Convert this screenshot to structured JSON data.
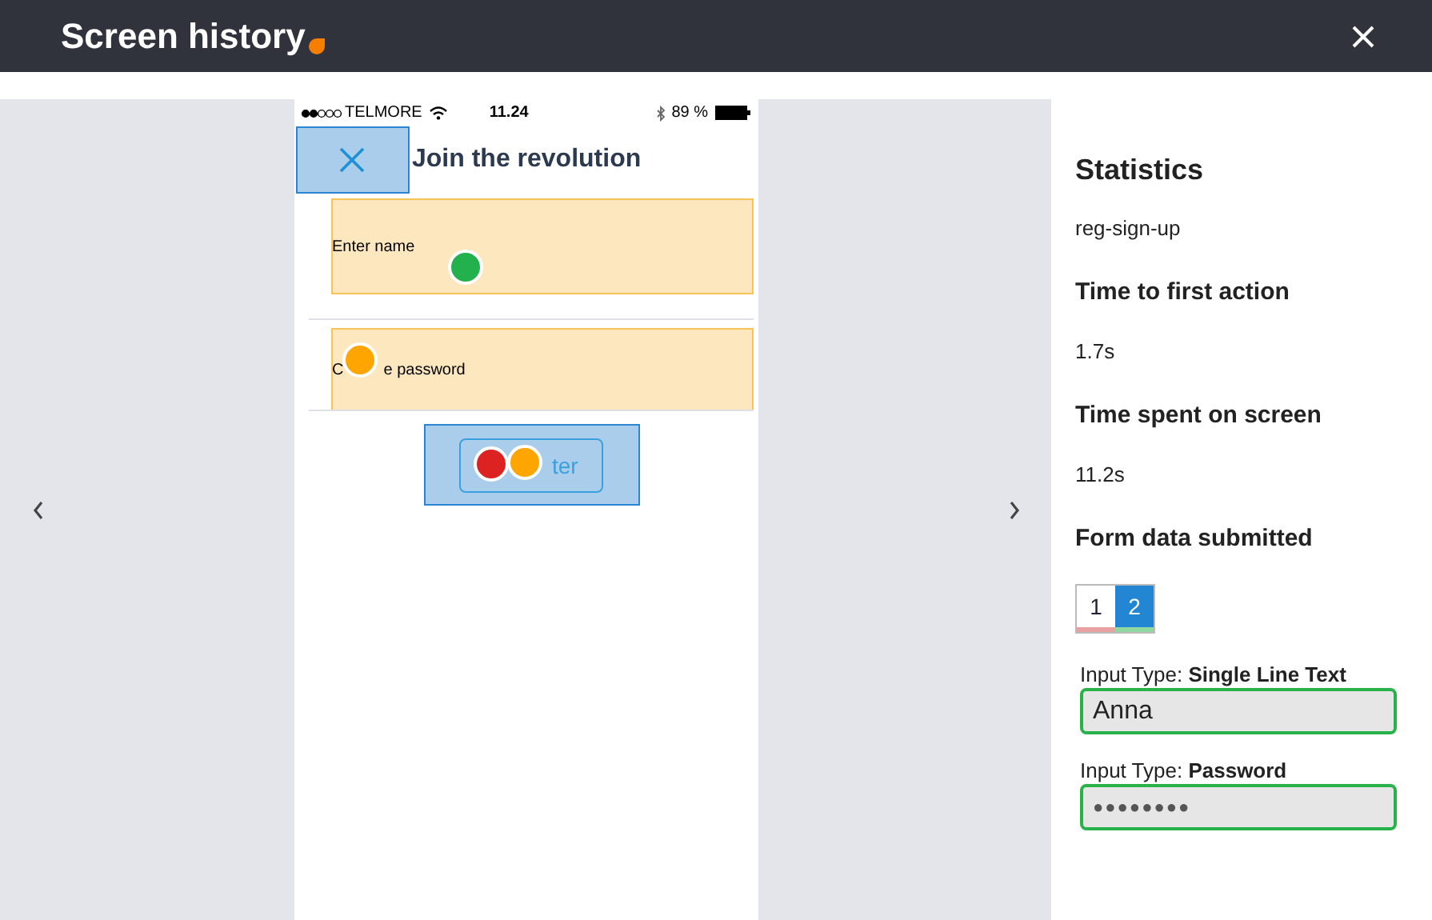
{
  "header": {
    "title": "Screen history"
  },
  "phone": {
    "status": {
      "carrier": "TELMORE",
      "time": "11.24",
      "battery": "89 %"
    },
    "title": "Join the revolution",
    "fields": [
      {
        "placeholder": "Enter name"
      },
      {
        "visible_parts": [
          "C",
          "e password"
        ]
      }
    ],
    "button": "ter",
    "taps": [
      {
        "color": "#22b14c"
      },
      {
        "color": "#ffa500"
      },
      {
        "color": "#dd2222"
      },
      {
        "color": "#ffa500"
      }
    ]
  },
  "stats": {
    "heading": "Statistics",
    "screen": "reg-sign-up",
    "metrics": [
      {
        "label": "Time to first action",
        "value": "1.7s"
      },
      {
        "label": "Time spent on screen",
        "value": "11.2s"
      }
    ],
    "form_heading": "Form data submitted",
    "pages": [
      {
        "label": "1",
        "selected": false,
        "color": "#e8a0a0"
      },
      {
        "label": "2",
        "selected": true,
        "color": "#90d8a0"
      }
    ],
    "inputs": [
      {
        "label": "Input Type: **Single Line Text**",
        "value": "Anna",
        "kind": "text"
      },
      {
        "label": "Input Type: **Password**",
        "value": "●●●●●●●●",
        "kind": "password"
      }
    ]
  }
}
